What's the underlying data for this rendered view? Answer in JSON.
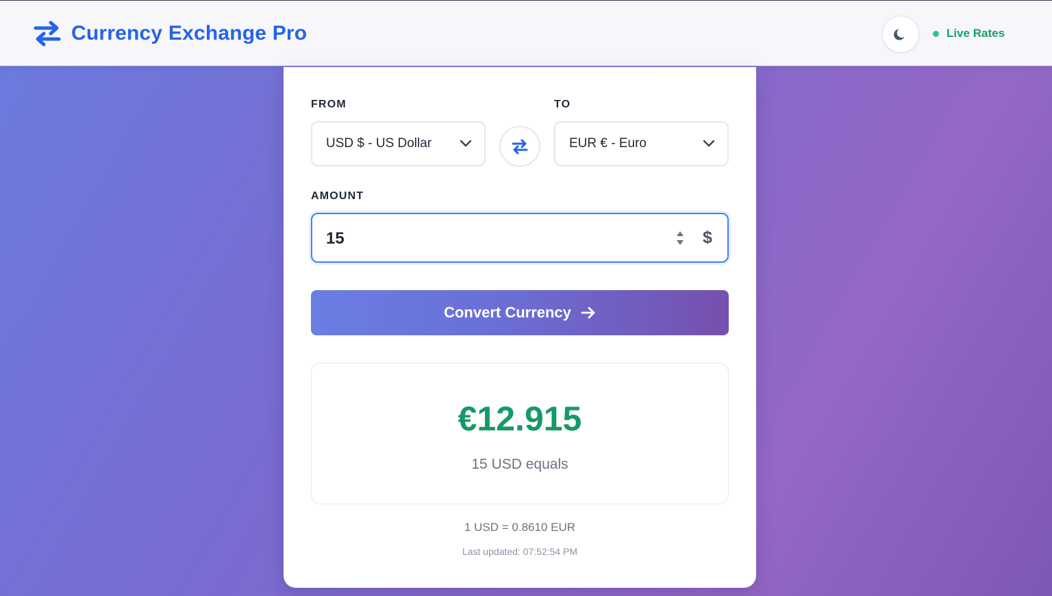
{
  "header": {
    "title": "Currency Exchange Pro",
    "brand_icon": "exchange-arrows-icon",
    "theme_toggle_icon": "moon-icon",
    "status_label": "Live Rates"
  },
  "converter": {
    "from_label": "FROM",
    "from_selected": "USD $ - US Dollar",
    "to_label": "TO",
    "to_selected": "EUR € - Euro",
    "swap_icon": "swap-arrows-icon",
    "amount_label": "AMOUNT",
    "amount_value": "15",
    "amount_currency_symbol": "$",
    "convert_label": "Convert Currency"
  },
  "result": {
    "converted_amount": "€12.915",
    "description": "15 USD equals",
    "rate": "1 USD = 0.8610 EUR",
    "last_updated": "Last updated: 07:52:54 PM"
  },
  "colors": {
    "accent": "#2563eb",
    "success": "#159a67",
    "live_status": "#16a06a",
    "button_gradient_start": "#6a7ee3",
    "button_gradient_end": "#7650ad"
  }
}
